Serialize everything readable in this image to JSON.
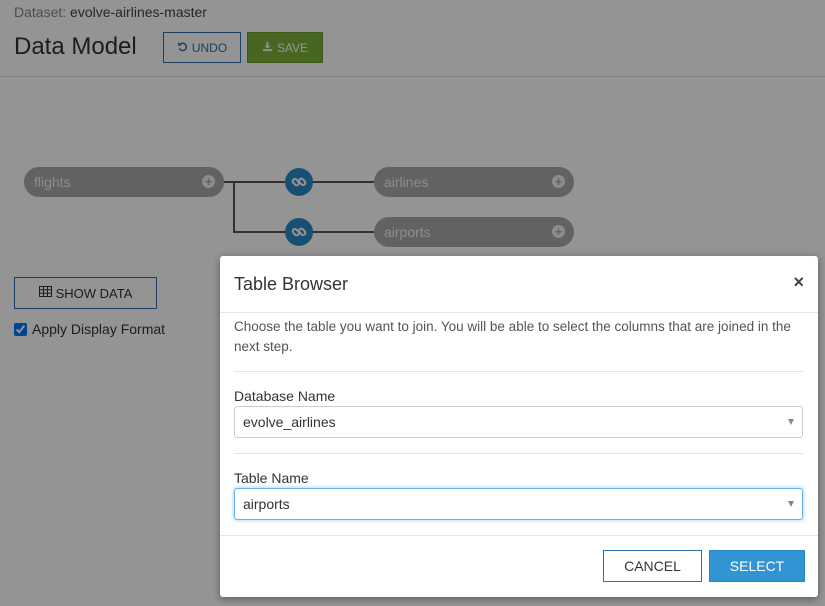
{
  "header": {
    "dataset_prefix": "Dataset:",
    "dataset_name": "evolve-airlines-master",
    "title": "Data Model",
    "undo_label": "UNDO",
    "save_label": "SAVE"
  },
  "diagram": {
    "root_table": "flights",
    "joined_tables": [
      "airlines",
      "airports"
    ]
  },
  "controls": {
    "show_data_label": "SHOW DATA",
    "apply_display_format_label": "Apply Display Format",
    "apply_display_format_checked": true
  },
  "modal": {
    "title": "Table Browser",
    "close_glyph": "×",
    "description": "Choose the table you want to join. You will be able to select the columns that are joined in the next step.",
    "database_label": "Database Name",
    "database_value": "evolve_airlines",
    "table_label": "Table Name",
    "table_value": "airports",
    "cancel_label": "CANCEL",
    "select_label": "SELECT"
  },
  "colors": {
    "primary": "#3194d3",
    "save_green": "#7bb03a",
    "link_blue": "#2a8bc9",
    "node_gray": "#a9a9a9"
  },
  "icons": [
    "undo-icon",
    "download-icon",
    "table-grid-icon",
    "link-icon",
    "plus-circle-icon",
    "close-icon",
    "caret-down-icon"
  ]
}
